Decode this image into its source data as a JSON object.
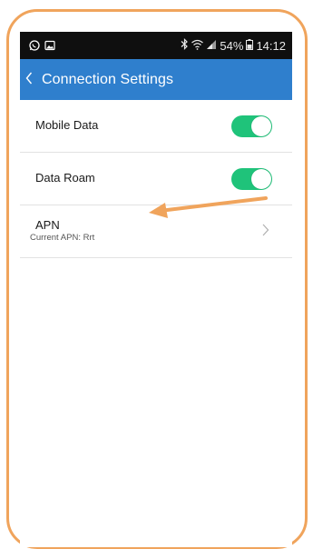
{
  "status_bar": {
    "battery_percent": "54%",
    "time": "14:12",
    "icons": [
      "whatsapp-icon",
      "gallery-icon",
      "bluetooth-icon",
      "wifi-icon",
      "signal-icon",
      "battery-icon"
    ]
  },
  "app_bar": {
    "title": "Connection Settings",
    "back_icon": "chevron-left-icon"
  },
  "settings": {
    "mobile_data": {
      "label": "Mobile Data",
      "enabled": true
    },
    "data_roam": {
      "label": "Data Roam",
      "enabled": true
    },
    "apn": {
      "label": "APN",
      "current": "Current APN:  Rrt"
    }
  },
  "colors": {
    "app_bar": "#2f7fcd",
    "toggle_on": "#1fc37a",
    "frame_border": "#f0a45c",
    "annotation_arrow": "#f0a45c"
  }
}
